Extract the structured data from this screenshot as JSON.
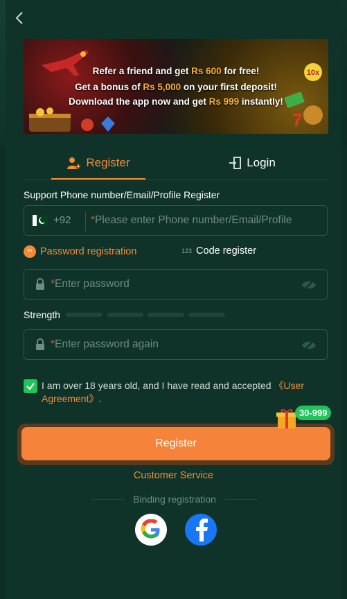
{
  "banner": {
    "line1_pre": "Refer a friend and get ",
    "line1_hl": "Rs 600",
    "line1_post": " for free!",
    "line2_pre": "Get a bonus of ",
    "line2_hl": "Rs 5,000",
    "line2_post": " on your first deposit!",
    "line3_pre": "Download the app now and get ",
    "line3_hl": "Rs 999",
    "line3_post": " instantly!",
    "badge_10x": "10x"
  },
  "tabs": {
    "register": "Register",
    "login": "Login"
  },
  "phone": {
    "label": "Support Phone number/Email/Profile Register",
    "country_code": "+92",
    "required_mark": "*",
    "placeholder": "Please enter Phone number/Email/Profile"
  },
  "modes": {
    "password": "Password registration",
    "password_icon": "**",
    "code": "Code register",
    "code_icon": "123"
  },
  "password": {
    "required_mark": "*",
    "placeholder": "Enter password"
  },
  "strength": {
    "label": "Strength",
    "level": 0,
    "segments": 4
  },
  "confirm": {
    "required_mark": "*",
    "placeholder": "Enter password again"
  },
  "agreement": {
    "checked": true,
    "text": "I am over 18 years old, and I have read and accepted ",
    "link": "《User Agreement》",
    "suffix": "."
  },
  "promo_badge": "30-999",
  "register_button": "Register",
  "customer_service": "Customer Service",
  "binding": "Binding registration",
  "colors": {
    "accent": "#f58a36",
    "background": "#0f3328",
    "success": "#1fc45a",
    "facebook": "#1877f2"
  }
}
